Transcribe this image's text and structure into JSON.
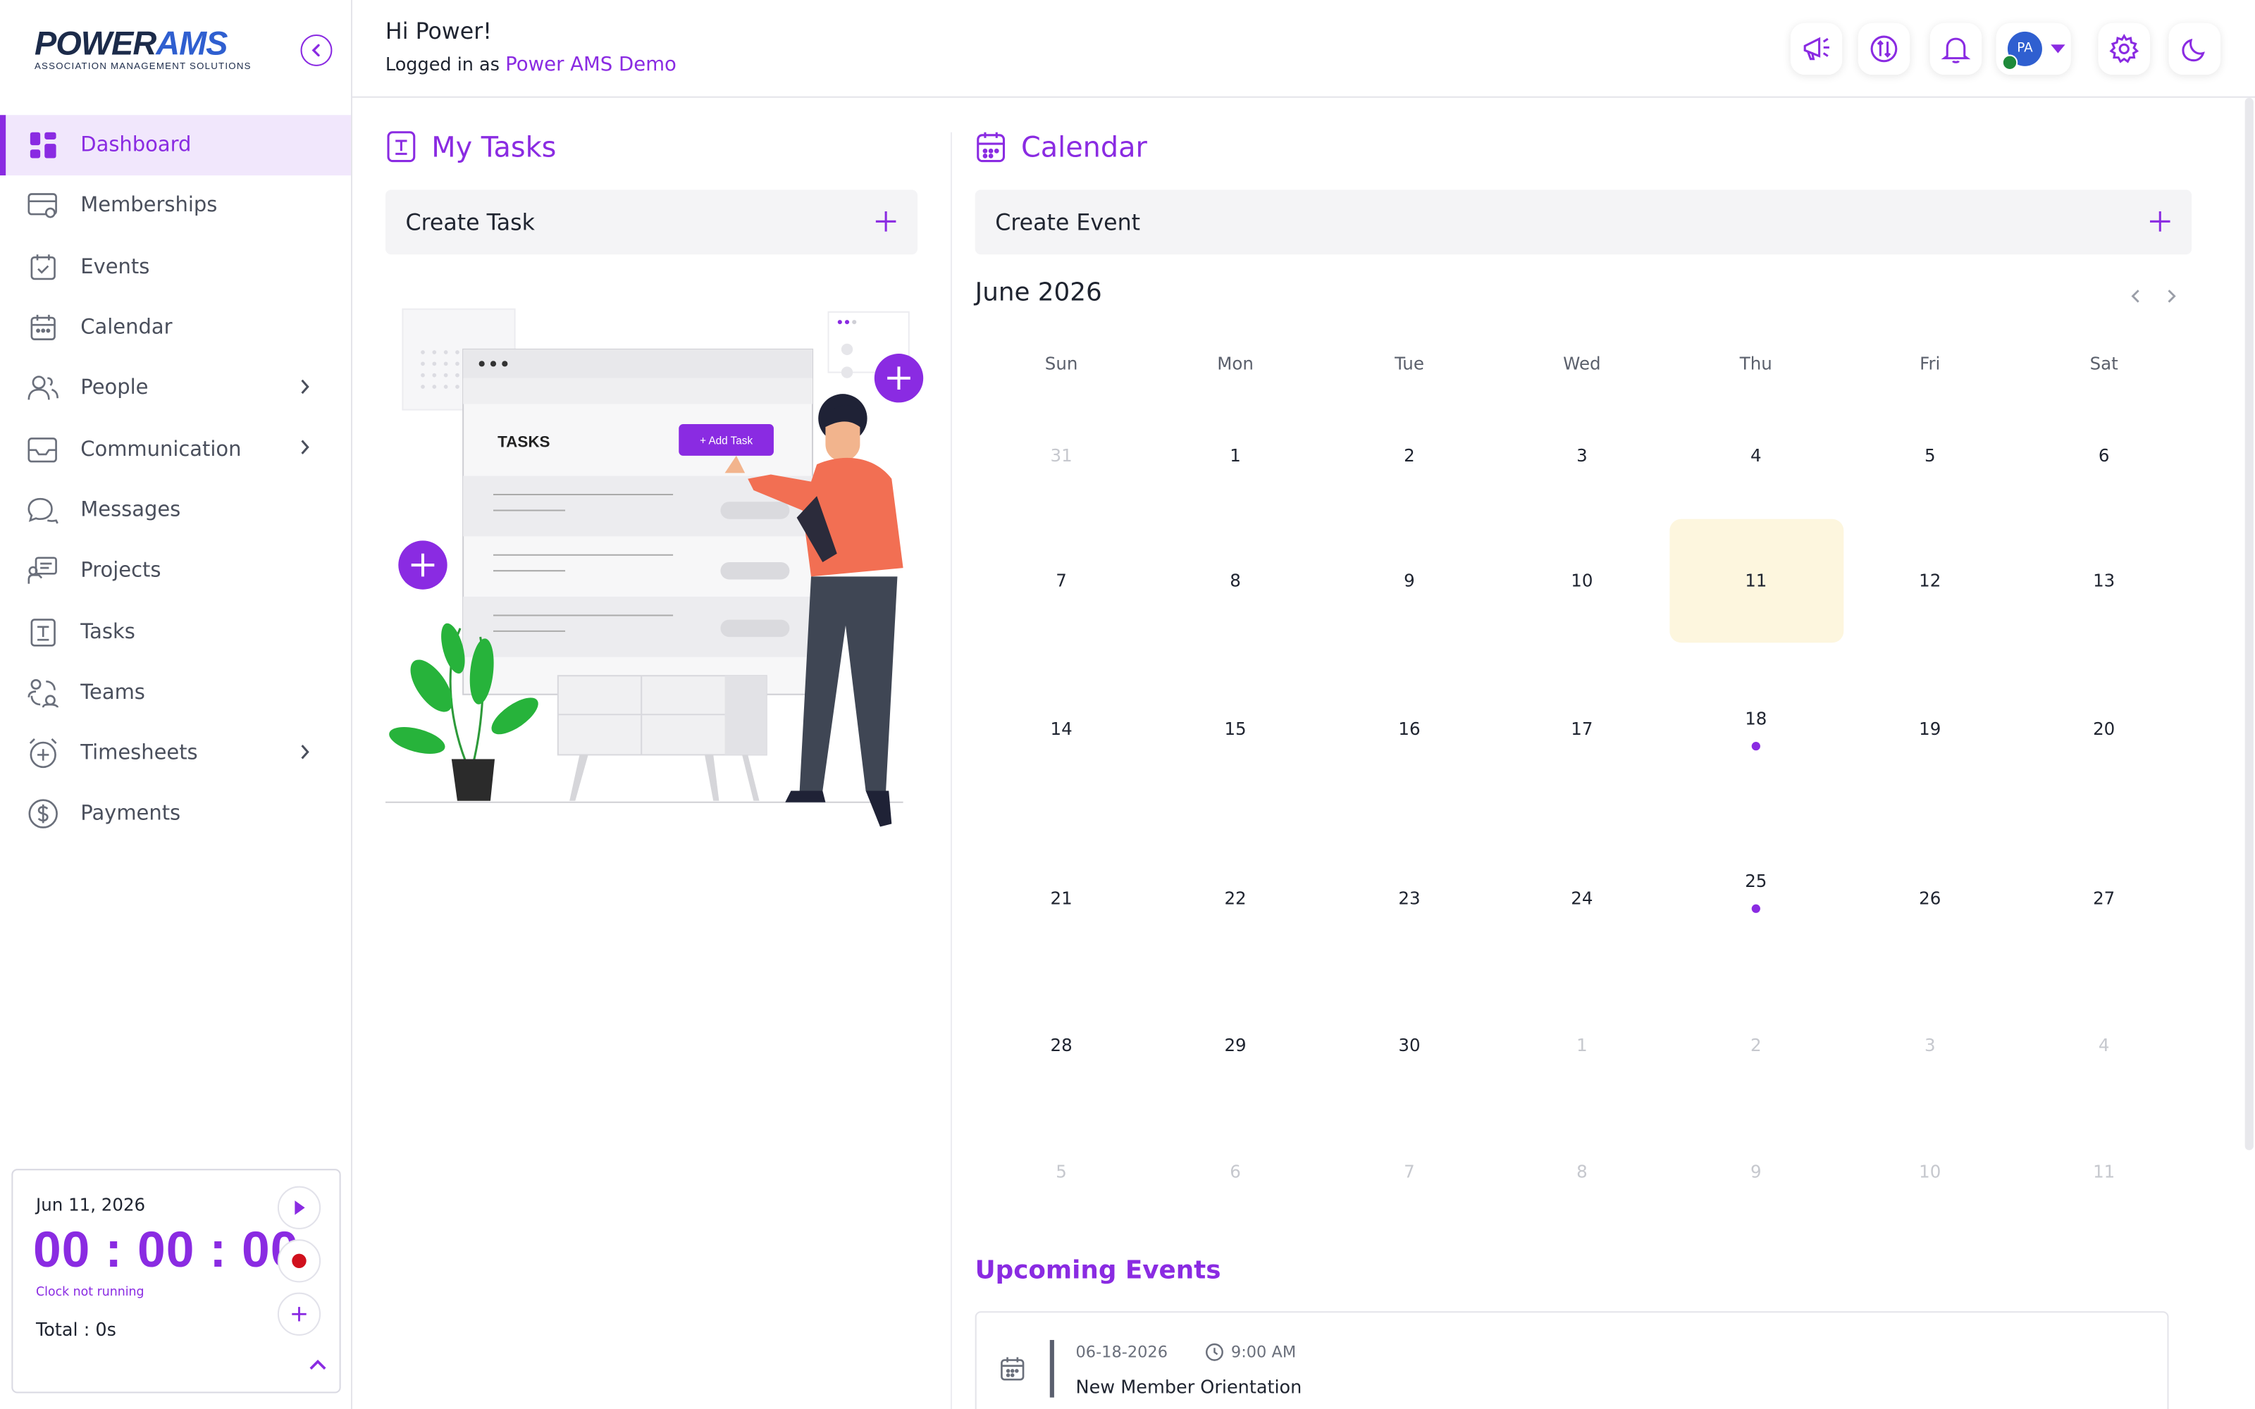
{
  "brand": {
    "name_a": "POWER",
    "name_b": "AMS",
    "tagline": "ASSOCIATION MANAGEMENT SOLUTIONS"
  },
  "header": {
    "greeting": "Hi Power!",
    "logged_in_prefix": "Logged in as",
    "account_name": "Power AMS Demo",
    "avatar_initials": "PA"
  },
  "sidebar": {
    "items": [
      {
        "label": "Dashboard",
        "icon": "dashboard-icon",
        "active": true
      },
      {
        "label": "Memberships",
        "icon": "membership-card-icon"
      },
      {
        "label": "Events",
        "icon": "event-icon"
      },
      {
        "label": "Calendar",
        "icon": "calendar-icon"
      },
      {
        "label": "People",
        "icon": "people-icon",
        "has_children": true
      },
      {
        "label": "Communication",
        "icon": "mail-icon",
        "has_children": true
      },
      {
        "label": "Messages",
        "icon": "chat-icon"
      },
      {
        "label": "Projects",
        "icon": "projects-icon"
      },
      {
        "label": "Tasks",
        "icon": "tasks-icon"
      },
      {
        "label": "Teams",
        "icon": "teams-icon"
      },
      {
        "label": "Timesheets",
        "icon": "timesheet-icon",
        "has_children": true
      },
      {
        "label": "Payments",
        "icon": "payment-icon"
      }
    ]
  },
  "timer": {
    "date": "Jun 11, 2026",
    "time": "00 : 00 : 00",
    "status": "Clock not running",
    "total": "Total : 0s"
  },
  "tasks": {
    "title": "My Tasks",
    "create_label": "Create Task",
    "illustration": {
      "panel_title": "TASKS",
      "button": "+ Add Task"
    }
  },
  "calendar": {
    "title": "Calendar",
    "create_label": "Create Event",
    "month_label": "June 2026",
    "weekdays": [
      "Sun",
      "Mon",
      "Tue",
      "Wed",
      "Thu",
      "Fri",
      "Sat"
    ],
    "weeks": [
      [
        "31",
        "1",
        "2",
        "3",
        "4",
        "5",
        "6"
      ],
      [
        "7",
        "8",
        "9",
        "10",
        "11",
        "12",
        "13"
      ],
      [
        "14",
        "15",
        "16",
        "17",
        "18",
        "19",
        "20"
      ],
      [
        "21",
        "22",
        "23",
        "24",
        "25",
        "26",
        "27"
      ],
      [
        "28",
        "29",
        "30",
        "1",
        "2",
        "3",
        "4"
      ],
      [
        "5",
        "6",
        "7",
        "8",
        "9",
        "10",
        "11"
      ]
    ],
    "today": "11",
    "event_days": [
      "18",
      "25"
    ]
  },
  "upcoming": {
    "title": "Upcoming Events",
    "events": [
      {
        "date": "06-18-2026",
        "time": "9:00 AM",
        "name": "New Member Orientation"
      }
    ]
  },
  "colors": {
    "accent": "#8a2be2",
    "today_bg": "#fdf6de",
    "brand_blue": "#2f5fd0"
  }
}
